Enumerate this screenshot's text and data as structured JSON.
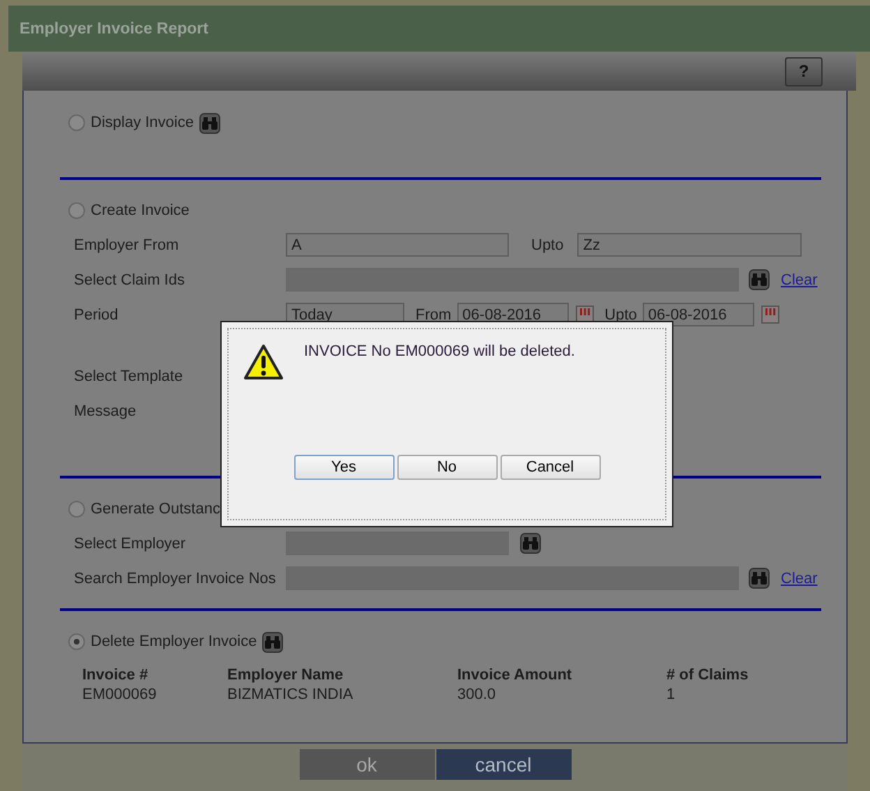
{
  "window": {
    "title": "Employer Invoice Report"
  },
  "help_button": "?",
  "display_section": {
    "label": "Display Invoice",
    "selected": false
  },
  "create_section": {
    "label": "Create Invoice",
    "selected": false,
    "employer_from": {
      "label": "Employer From",
      "value": "A"
    },
    "upto": {
      "label": "Upto",
      "value": "Zz"
    },
    "claim_ids": {
      "label": "Select Claim Ids",
      "link": "Clear"
    },
    "period": {
      "label": "Period",
      "value": "Today",
      "from_label": "From",
      "from_value": "06-08-2016",
      "upto_label": "Upto",
      "upto_value": "06-08-2016"
    },
    "template": {
      "label": "Select Template"
    },
    "message": {
      "label": "Message"
    }
  },
  "generate_section": {
    "label": "Generate Outstanc",
    "selected": false,
    "select_employer": {
      "label": "Select Employer"
    },
    "search_invoices": {
      "label": "Search Employer Invoice Nos",
      "link": "Clear"
    }
  },
  "delete_section": {
    "label": "Delete Employer Invoice",
    "selected": true,
    "table": {
      "columns": [
        "Invoice #",
        "Employer Name",
        "Invoice Amount",
        "# of Claims"
      ],
      "rows": [
        [
          "EM000069",
          "BIZMATICS INDIA",
          "300.0",
          "1"
        ]
      ]
    }
  },
  "footer_buttons": [
    {
      "label": "ok",
      "disabled": true
    },
    {
      "label": "cancel",
      "disabled": false
    }
  ],
  "dialog": {
    "message": "INVOICE No EM000069 will be deleted.",
    "buttons": [
      {
        "label": "Yes",
        "selected": true
      },
      {
        "label": "No",
        "selected": false
      },
      {
        "label": "Cancel",
        "selected": false
      }
    ]
  }
}
